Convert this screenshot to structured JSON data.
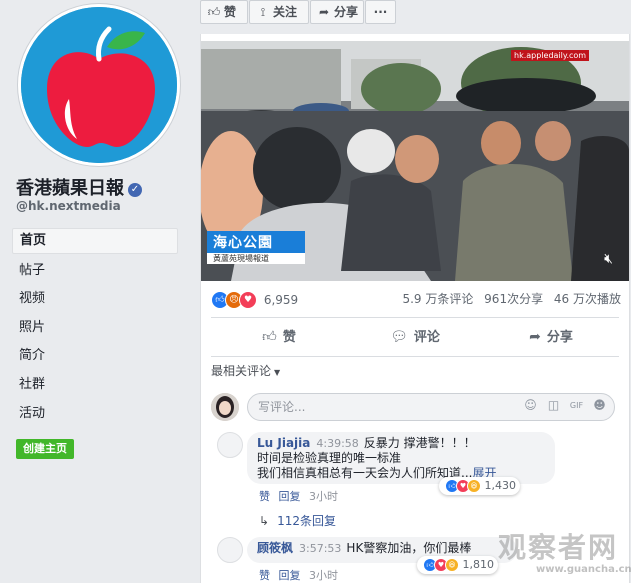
{
  "page": {
    "name": "香港蘋果日報",
    "handle": "@hk.nextmedia",
    "verified_icon": "verified-check-icon",
    "logo_colors": {
      "background": "#1f9ad6",
      "apple": "#ed1c3f",
      "leaf": "#39b54a"
    }
  },
  "nav": {
    "items": [
      {
        "label": "首页",
        "active": true
      },
      {
        "label": "帖子"
      },
      {
        "label": "视频"
      },
      {
        "label": "照片"
      },
      {
        "label": "简介"
      },
      {
        "label": "社群"
      },
      {
        "label": "活动"
      }
    ],
    "create_page": "创建主页"
  },
  "topbar": {
    "like": "赞",
    "like_icon": "thumbs-up-icon",
    "follow": "关注",
    "follow_icon": "rss-icon",
    "share": "分享",
    "share_icon": "share-arrow-icon",
    "more": "···"
  },
  "video": {
    "site_watermark": "hk.appledaily.com",
    "location_title": "海心公園",
    "location_sub": "黃蘆苑現場報道",
    "volume_icon": "muted-speaker-icon"
  },
  "stats": {
    "reactions": [
      "like",
      "angry",
      "love"
    ],
    "reaction_count": "6,959",
    "comments": "5.9 万条评论",
    "shares": "961次分享",
    "views": "46 万次播放"
  },
  "actions": {
    "like": "赞",
    "comment": "评论",
    "share": "分享"
  },
  "comments_section": {
    "sort_label": "最相关评论",
    "composer_placeholder": "写评论...",
    "composer_icons": [
      "emoji-icon",
      "camera-icon",
      "gif-icon",
      "sticker-icon"
    ],
    "comments": [
      {
        "author": "Lu Jiajia",
        "time": "4:39:58",
        "lines": [
          "反暴力 撑港警！！！",
          "时间是检验真理的唯一标准",
          "我们相信真相总有一天会为人们所知道..."
        ],
        "more": "展开",
        "reactions": [
          "like",
          "love",
          "haha"
        ],
        "reaction_count": "1,430",
        "like": "赞",
        "reply": "回复",
        "age": "3小时",
        "replies": "112条回复"
      },
      {
        "author": "顾筱枫",
        "time": "3:57:53",
        "lines": [
          "HK警察加油，你们最棒"
        ],
        "reactions": [
          "like",
          "love",
          "haha"
        ],
        "reaction_count": "1,810",
        "like": "赞",
        "reply": "回复",
        "age": "3小时"
      }
    ]
  },
  "overlay_watermark": {
    "text": "观察者网",
    "url": "www.guancha.cn"
  }
}
